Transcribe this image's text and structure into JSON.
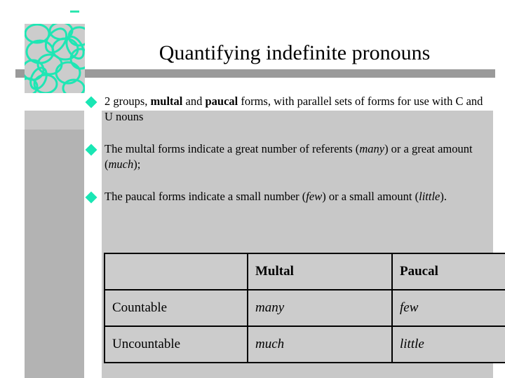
{
  "slide": {
    "title": "Quantifying indefinite pronouns",
    "decoration": {
      "motif_icon": "interlocking-circles-icon",
      "motif_color": "#1fe6b4",
      "bar_color": "#9a9a9a",
      "panel_color": "#c8c8c8",
      "column_color": "#b3b3b3"
    },
    "bullets": [
      {
        "marker_icon": "diamond-bullet-icon",
        "text": "2 groups, multal and paucal forms, with parallel sets of forms for use with C and U nouns",
        "html": "2 groups, <b>multal</b> and <b>paucal</b> forms, with parallel sets of forms for use with C and U nouns"
      },
      {
        "marker_icon": "diamond-bullet-icon",
        "text": "The multal forms indicate a great number of referents (many) or a great amount (much);",
        "html": "The multal forms indicate a great number of referents (<i>many</i>) or a great amount (<i>much</i>);"
      },
      {
        "marker_icon": "diamond-bullet-icon",
        "text": "The paucal forms indicate a small number (few) or a small amount (little).",
        "html": "The paucal forms indicate a small number (<i>few</i>) or a small amount (<i>little</i>)."
      }
    ],
    "table": {
      "accent_color": "#cc1f2e",
      "headers": [
        "",
        "Multal",
        "Paucal"
      ],
      "rows": [
        {
          "label": "Countable",
          "multal": "many",
          "paucal": "few"
        },
        {
          "label": "Uncountable",
          "multal": "much",
          "paucal": "little"
        }
      ]
    }
  }
}
